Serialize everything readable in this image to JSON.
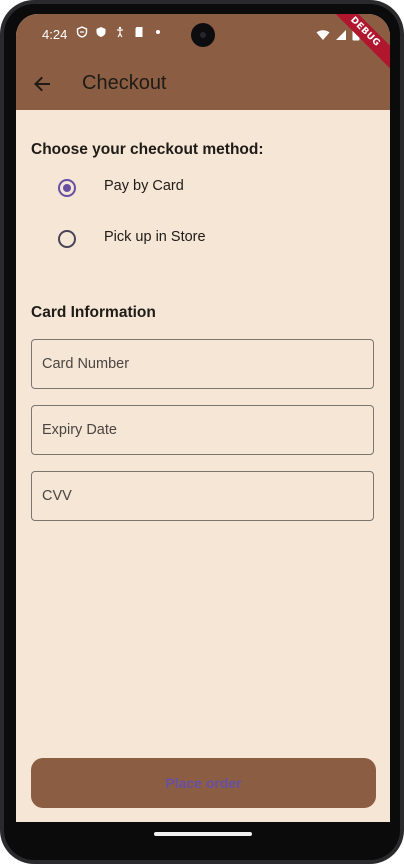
{
  "status_bar": {
    "time": "4:24",
    "left_icons": [
      "shield-icon",
      "shield-solid-icon",
      "a11y-icon",
      "sd-card-icon",
      "dot-icon"
    ],
    "right_icons": [
      "wifi-icon",
      "signal-icon",
      "battery-icon"
    ]
  },
  "debug_banner": "DEBUG",
  "app_bar": {
    "title": "Checkout",
    "back_icon": "arrow-back-icon"
  },
  "checkout": {
    "method_heading": "Choose your checkout method:",
    "options": [
      {
        "label": "Pay by Card",
        "selected": true
      },
      {
        "label": "Pick up in Store",
        "selected": false
      }
    ]
  },
  "card_info": {
    "heading": "Card Information",
    "fields": [
      {
        "label": "Card Number",
        "value": ""
      },
      {
        "label": "Expiry Date",
        "value": ""
      },
      {
        "label": "CVV",
        "value": ""
      }
    ]
  },
  "actions": {
    "place_order": "Place order"
  },
  "colors": {
    "app_bar": "#8b5e44",
    "background": "#f5e6d6",
    "accent": "#6750a4"
  }
}
